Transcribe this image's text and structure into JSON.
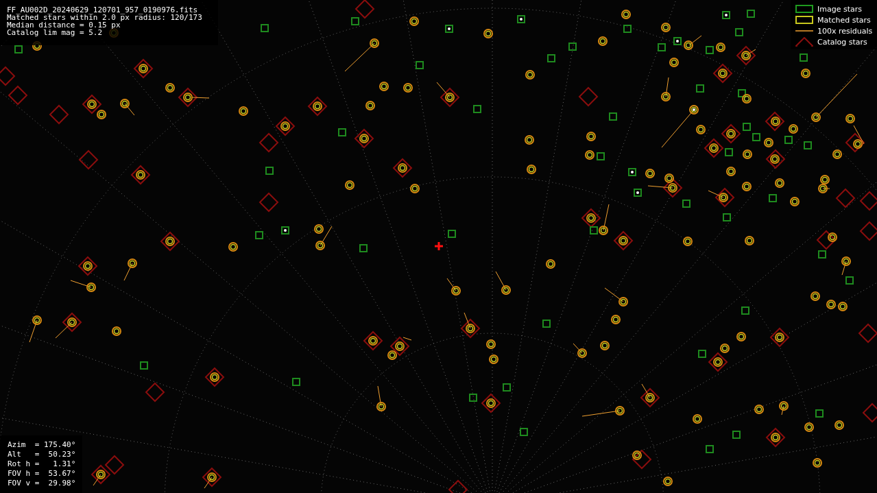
{
  "info": {
    "lines": [
      "FF_AU002D_20240629_120701_957_0190976.fits",
      "Matched stars within 2.0 px radius: 120/173",
      "Median distance = 0.15 px",
      "Catalog lim mag = 5.2"
    ]
  },
  "legend": [
    {
      "kind": "image",
      "label": "Image stars"
    },
    {
      "kind": "matched",
      "label": "Matched stars"
    },
    {
      "kind": "residual",
      "label": "100x residuals"
    },
    {
      "kind": "catalog",
      "label": "Catalog stars"
    }
  ],
  "pointing": {
    "lines": [
      "Azim  = 175.40°",
      "Alt   =  50.23°",
      "Rot h =   1.31°",
      "FOV h =  53.67°",
      "FOV v =  29.98°"
    ]
  }
}
